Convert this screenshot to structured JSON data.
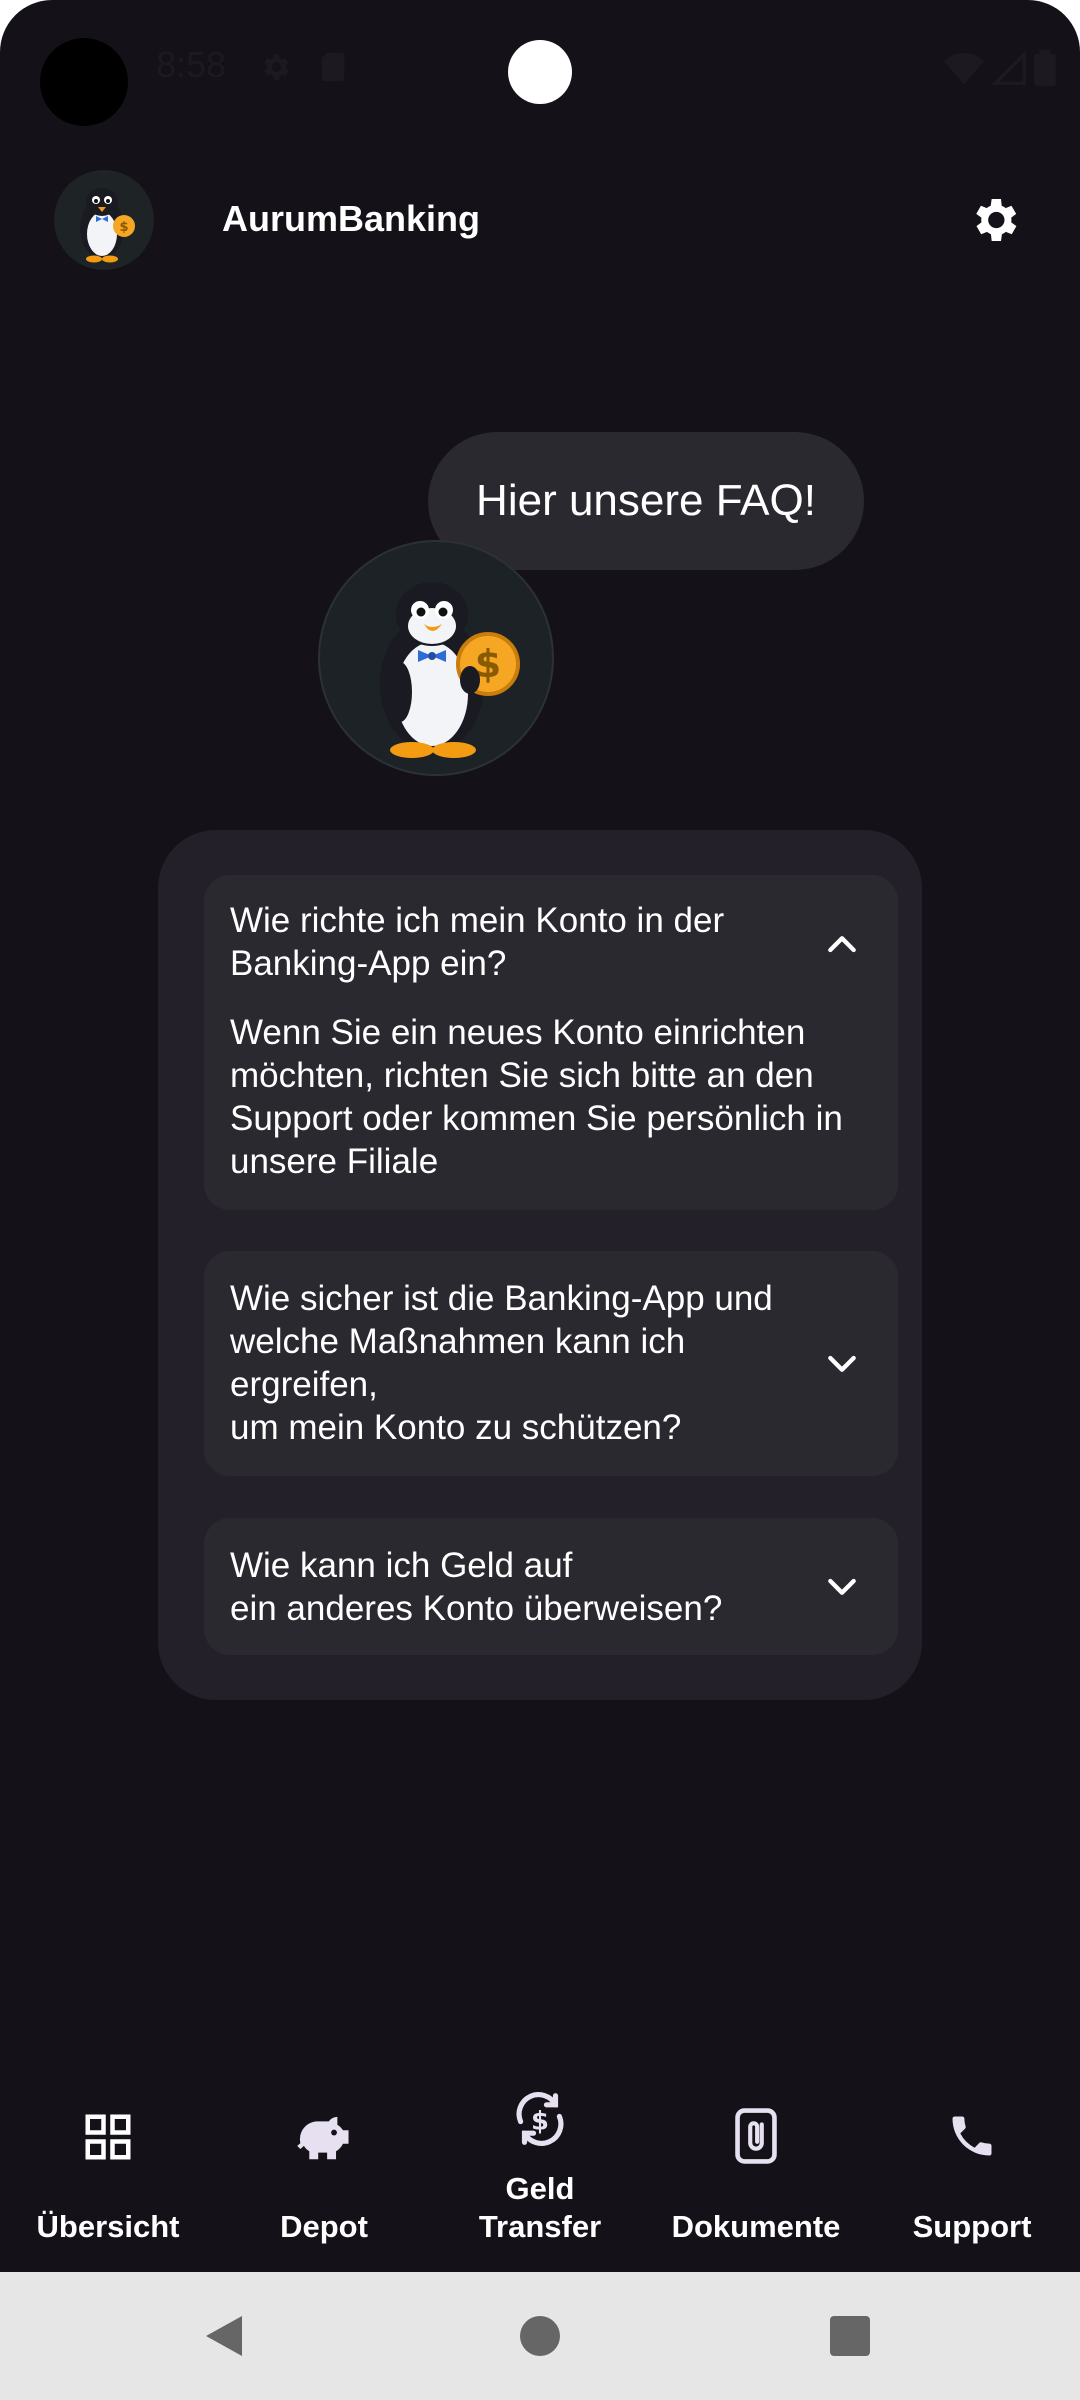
{
  "status_bar": {
    "time": "8:58"
  },
  "app_bar": {
    "title": "AurumBanking"
  },
  "chat": {
    "message": "Hier unsere FAQ!"
  },
  "faq": {
    "items": [
      {
        "question_lines": [
          "Wie richte ich mein Konto in der",
          "Banking-App ein?"
        ],
        "answer_lines": [
          "Wenn Sie ein neues Konto einrichten",
          "möchten, richten Sie sich bitte an den",
          "Support oder kommen Sie persönlich in",
          "unsere Filiale"
        ],
        "expanded": true
      },
      {
        "question_lines": [
          "Wie sicher ist die Banking-App und",
          "welche Maßnahmen kann ich",
          "ergreifen,",
          "um mein Konto zu schützen?"
        ],
        "expanded": false
      },
      {
        "question_lines": [
          "Wie kann ich Geld auf",
          "ein anderes Konto überweisen?"
        ],
        "expanded": false
      }
    ]
  },
  "bottom_nav": {
    "items": [
      {
        "label": "Übersicht",
        "icon": "grid-icon"
      },
      {
        "label": "Depot",
        "icon": "piggy-bank-icon"
      },
      {
        "label_lines": [
          "Geld",
          "Transfer"
        ],
        "icon": "money-transfer-icon"
      },
      {
        "label": "Dokumente",
        "icon": "document-clip-icon"
      },
      {
        "label": "Support",
        "icon": "phone-icon"
      }
    ]
  },
  "colors": {
    "background": "#141218",
    "surface": "#232029",
    "surface_item": "#2b2930",
    "text": "#ffffff",
    "system_nav": "#e6e6e6"
  }
}
